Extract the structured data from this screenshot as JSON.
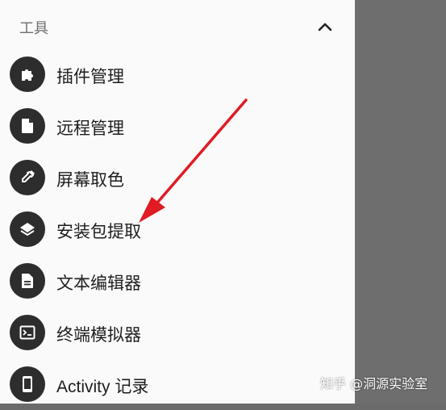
{
  "drawer": {
    "section_title": "工具",
    "items": [
      {
        "label": "插件管理",
        "icon": "puzzle-icon"
      },
      {
        "label": "远程管理",
        "icon": "file-icon"
      },
      {
        "label": "屏幕取色",
        "icon": "eyedropper-icon"
      },
      {
        "label": "安装包提取",
        "icon": "layers-icon"
      },
      {
        "label": "文本编辑器",
        "icon": "document-icon"
      },
      {
        "label": "终端模拟器",
        "icon": "terminal-icon"
      },
      {
        "label": "Activity 记录",
        "icon": "phone-icon"
      }
    ]
  },
  "watermark": "知乎 @洞源实验室",
  "colors": {
    "panel_bg": "#fafafa",
    "scrim": "#6b6b6b",
    "icon_bg": "#2d2d2d",
    "arrow": "#e01b24"
  }
}
